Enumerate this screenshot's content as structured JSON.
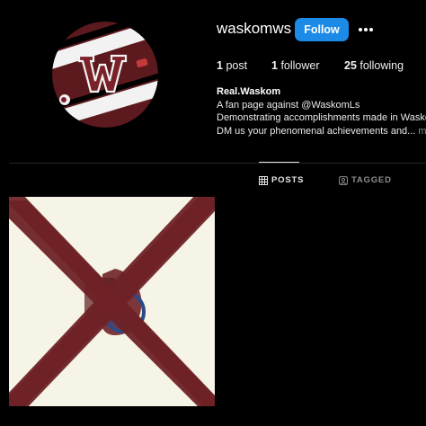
{
  "profile": {
    "username": "waskomws",
    "follow_label": "Follow",
    "more_label": "•••"
  },
  "stats": {
    "posts_count": "1",
    "posts_label": "post",
    "followers_count": "1",
    "followers_label": "follower",
    "following_count": "25",
    "following_label": "following"
  },
  "bio": {
    "name": "Real.Waskom",
    "line1": "A fan page against @WaskomLs",
    "line2": "Demonstrating accomplishments made in Waskom",
    "line3": "DM us your phenomenal achievements and...",
    "more": "more"
  },
  "tabs": [
    {
      "label": "POSTS",
      "icon": "grid-icon",
      "active": true
    },
    {
      "label": "TAGGED",
      "icon": "tag-icon",
      "active": false
    }
  ],
  "colors": {
    "accent": "#1c8be8",
    "maroon": "#6e2226",
    "post_background": "#f6f3e7"
  }
}
